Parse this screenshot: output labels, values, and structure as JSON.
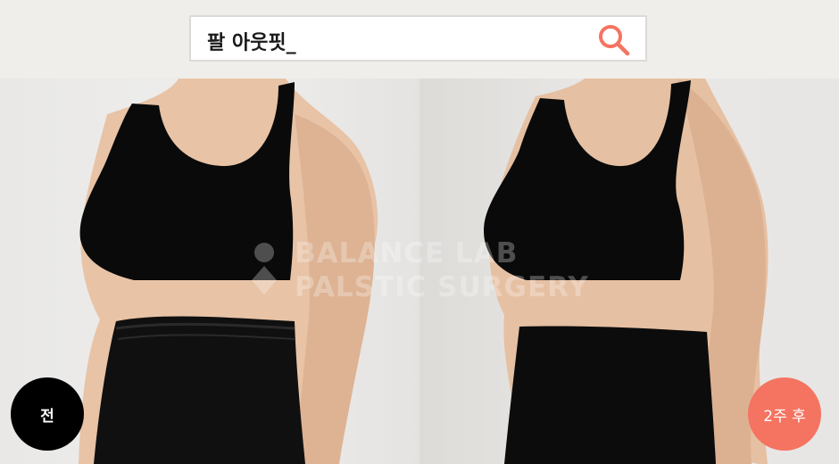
{
  "search": {
    "query": "팔 아웃핏_",
    "icon": "search-icon",
    "icon_color": "#f47461"
  },
  "watermark": {
    "line1": "BALANCE LAB",
    "line2": "PALSTIC SURGERY"
  },
  "badges": {
    "before": "전",
    "after": "2주 후",
    "before_color": "#000000",
    "after_color": "#f47461"
  }
}
